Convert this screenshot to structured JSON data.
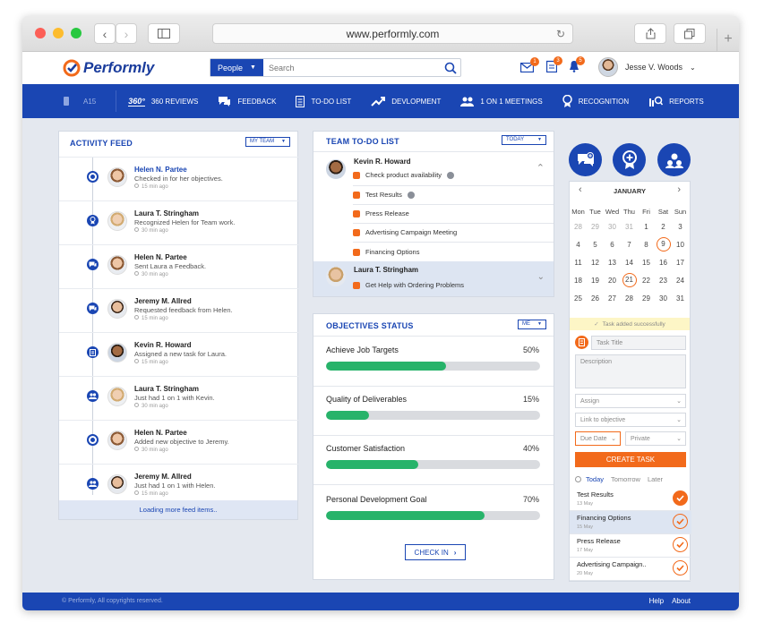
{
  "browser": {
    "url": "www.performly.com"
  },
  "header": {
    "logo_text": "Performly",
    "search": {
      "scope": "People",
      "placeholder": "Search"
    },
    "badges": {
      "mail": "1",
      "tasks": "3",
      "alerts": "5"
    },
    "user_name": "Jesse V. Woods"
  },
  "menu": {
    "score": "A15",
    "items": [
      {
        "label": "360 REVIEWS",
        "icon_text": "360°"
      },
      {
        "label": "FEEDBACK"
      },
      {
        "label": "TO-DO LIST"
      },
      {
        "label": "DEVLOPMENT"
      },
      {
        "label": "1 ON 1 MEETINGS"
      },
      {
        "label": "RECOGNITION"
      },
      {
        "label": "REPORTS"
      }
    ]
  },
  "activity_feed": {
    "title": "ACTIVITY FEED",
    "filter": "MY TEAM",
    "items": [
      {
        "name": "Helen N. Partee",
        "text": "Checked in for her objectives.",
        "time": "15 min ago",
        "icon": "target-icon"
      },
      {
        "name": "Laura T. Stringham",
        "text": "Recognized Helen for Team work.",
        "time": "30 min ago",
        "icon": "award-icon"
      },
      {
        "name": "Helen N. Partee",
        "text": "Sent Laura a Feedback.",
        "time": "30 min ago",
        "icon": "chat-icon"
      },
      {
        "name": "Jeremy M. Allred",
        "text": "Requested feedback from Helen.",
        "time": "15 min ago",
        "icon": "chat-icon"
      },
      {
        "name": "Kevin R. Howard",
        "text": "Assigned a new task for Laura.",
        "time": "15 min ago",
        "icon": "clipboard-icon"
      },
      {
        "name": "Laura T. Stringham",
        "text": "Just had 1 on 1 with Kevin.",
        "time": "30 min ago",
        "icon": "people-icon"
      },
      {
        "name": "Helen N. Partee",
        "text": "Added new objective to Jeremy.",
        "time": "30 min ago",
        "icon": "target-icon"
      },
      {
        "name": "Jeremy M. Allred",
        "text": "Just had 1 on 1 with Helen.",
        "time": "15 min ago",
        "icon": "people-icon"
      }
    ],
    "load_more": "Loading more feed items.."
  },
  "team_todo": {
    "title": "TEAM TO-DO LIST",
    "filter": "TODAY",
    "kevin": {
      "name": "Kevin R. Howard",
      "tasks": [
        "Check product availability",
        "Test Results",
        "Press Release",
        "Advertising Campaign Meeting",
        "Financing Options"
      ]
    },
    "laura": {
      "name": "Laura T. Stringham",
      "task": "Get Help with Ordering Problems"
    }
  },
  "objectives": {
    "title": "OBJECTIVES STATUS",
    "filter": "ME",
    "items": [
      {
        "name": "Achieve Job Targets",
        "pct_label": "50%",
        "value": 0.56
      },
      {
        "name": "Quality of Deliverables",
        "pct_label": "15%",
        "value": 0.2
      },
      {
        "name": "Customer Satisfaction",
        "pct_label": "40%",
        "value": 0.43
      },
      {
        "name": "Personal Development Goal",
        "pct_label": "70%",
        "value": 0.74
      }
    ],
    "checkin": "CHECK IN"
  },
  "calendar": {
    "month": "JANUARY",
    "weekdays": [
      "Mon",
      "Tue",
      "Wed",
      "Thu",
      "Fri",
      "Sat",
      "Sun"
    ],
    "weeks": [
      [
        "28",
        "29",
        "30",
        "31",
        "1",
        "2",
        "3"
      ],
      [
        "4",
        "5",
        "6",
        "7",
        "8",
        "9",
        "10"
      ],
      [
        "11",
        "12",
        "13",
        "14",
        "15",
        "16",
        "17"
      ],
      [
        "18",
        "19",
        "20",
        "21",
        "22",
        "23",
        "24"
      ],
      [
        "25",
        "26",
        "27",
        "28",
        "29",
        "30",
        "31"
      ]
    ],
    "muted_first_row": 4,
    "ringed_days": [
      "9",
      "21"
    ],
    "banner": "Task added successfully"
  },
  "task_form": {
    "title_placeholder": "Task Title",
    "description_placeholder": "Description",
    "assign": "Assign",
    "link": "Link to objective",
    "due": "Due Date",
    "privacy": "Private",
    "button": "CREATE TASK",
    "tabs": [
      "Today",
      "Tomorrow",
      "Later"
    ]
  },
  "task_list": [
    {
      "name": "Test Results",
      "date": "13 May",
      "done": true
    },
    {
      "name": "Financing Options",
      "date": "15 May",
      "done": false
    },
    {
      "name": "Press Release",
      "date": "17 May",
      "done": false
    },
    {
      "name": "Advertising Campaign..",
      "date": "20 May",
      "done": false
    }
  ],
  "footer": {
    "copyright": "© Performly, All copyrights reserved.",
    "help": "Help",
    "about": "About"
  },
  "colors": {
    "brand": "#1a46b3",
    "accent": "#f26a1b",
    "progress": "#27b36a"
  }
}
